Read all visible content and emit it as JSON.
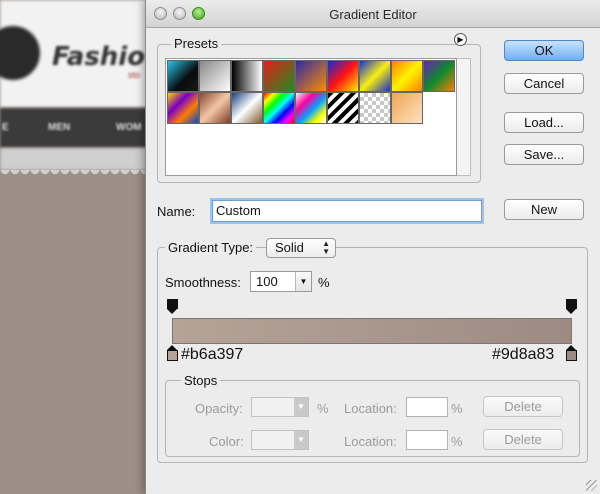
{
  "background_page": {
    "logo_text": "Fashio",
    "logo_sub": "sto",
    "nav_items": [
      "E",
      "MEN",
      "WOM"
    ]
  },
  "window": {
    "title": "Gradient Editor"
  },
  "presets": {
    "label": "Presets",
    "menu_icon": "triangle-right",
    "swatches": [
      {
        "name": "blue-cyan-black",
        "bg": "linear-gradient(135deg,#2ac4e8 0%,#0a0a0a 60%,#1b1b1b 100%)"
      },
      {
        "name": "transparent-checker",
        "bg": "linear-gradient(135deg,#888 0%,#fff 100%)"
      },
      {
        "name": "black-white",
        "bg": "linear-gradient(90deg,#000,#fff)"
      },
      {
        "name": "red-green",
        "bg": "linear-gradient(135deg,#e41d1d 0%,#1e8f1e 100%)"
      },
      {
        "name": "violet-orange",
        "bg": "linear-gradient(135deg,#2d2ba4 0%,#ff8a00 100%)"
      },
      {
        "name": "blue-red-yellow",
        "bg": "linear-gradient(135deg,#1528d6 0%,#ff1212 50%,#ffeb00 100%)"
      },
      {
        "name": "blue-yellow-blue",
        "bg": "linear-gradient(135deg,#1a2fd0 0%,#f8ef10 50%,#1a2fd0 100%)"
      },
      {
        "name": "orange-yellow-orange",
        "bg": "linear-gradient(135deg,#ff8000 0%,#fff400 50%,#ff8000 100%)"
      },
      {
        "name": "violet-green-orange",
        "bg": "linear-gradient(135deg,#6d1fb5 0%,#0c8a2c 50%,#ff7d00 100%)"
      },
      {
        "name": "yellow-violet-orange-blue",
        "bg": "linear-gradient(135deg,#ffd400 0%,#7a00c6 35%,#ff7d00 65%,#0049d4 100%)"
      },
      {
        "name": "copper",
        "bg": "linear-gradient(135deg,#8a4a2c 0%,#f3c6a8 50%,#7a3e24 100%)"
      },
      {
        "name": "chrome",
        "bg": "linear-gradient(135deg,#1a3f7a 0%,#ffffff 50%,#7a5a28 100%)"
      },
      {
        "name": "spectrum",
        "bg": "linear-gradient(135deg,#ff0000,#ffff00,#00ff00,#00ffff,#0000ff,#ff00ff,#ff0000)"
      },
      {
        "name": "transparent-rainbow",
        "bg": "linear-gradient(135deg,#f5f5f5 0%,#ff00a0 30%,#00a0ff 55%,#ffff00 80%,#fff 100%)"
      },
      {
        "name": "transparent-stripes",
        "bg": "repeating-linear-gradient(135deg,#000 0 4px,#fff 4px 8px)"
      },
      {
        "name": "checker",
        "bg": "repeating-conic-gradient(#c8c8c8 0 25%,#ffffff 0 50%) 0 0/8px 8px"
      },
      {
        "name": "orange-light",
        "bg": "linear-gradient(135deg,#f0a552 0%,#fbe2c3 100%)"
      }
    ]
  },
  "buttons": {
    "ok": "OK",
    "cancel": "Cancel",
    "load": "Load...",
    "save": "Save...",
    "new": "New"
  },
  "name_field": {
    "label": "Name:",
    "value": "Custom"
  },
  "gradient": {
    "type_label": "Gradient Type:",
    "type_value": "Solid",
    "smoothness_label": "Smoothness:",
    "smoothness_value": "100",
    "smoothness_unit": "%",
    "left_color": "#b6a397",
    "right_color": "#9d8a83",
    "left_color_label": "#b6a397",
    "right_color_label": "#9d8a83"
  },
  "stops": {
    "label": "Stops",
    "opacity_label": "Opacity:",
    "opacity_unit": "%",
    "opacity_location_label": "Location:",
    "opacity_location_unit": "%",
    "opacity_delete": "Delete",
    "color_label": "Color:",
    "color_location_label": "Location:",
    "color_location_unit": "%",
    "color_delete": "Delete"
  }
}
